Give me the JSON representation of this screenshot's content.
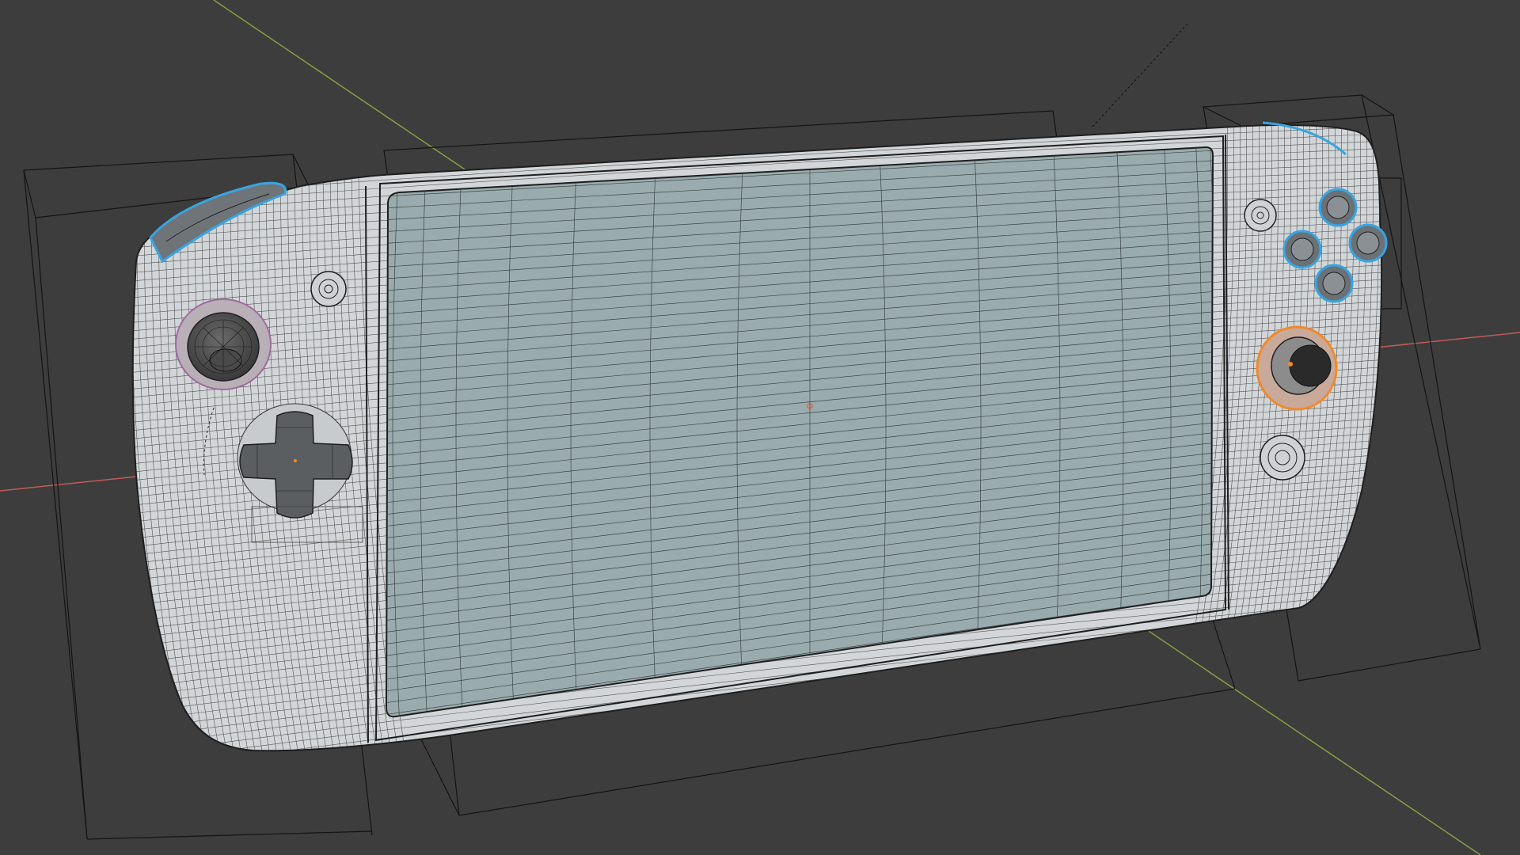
{
  "viewport": {
    "background": "#3d3d3d",
    "shading_mode": "wireframe-overlay-solid",
    "axis_colors": {
      "x": "#c25a5a",
      "y": "#84a040"
    },
    "selection_outline_color": "#38a4e0",
    "active_outline_color": "#f08a2c",
    "mesh_surface_color": "#d3d6d8",
    "screen_surface_color": "#9aabad",
    "wire_color": "#1e1e1e"
  },
  "scene": {
    "object_type": "handheld-game-console",
    "selected_parts": [
      "shoulder-button-left",
      "shoulder-button-right",
      "face-button-x",
      "face-button-y",
      "face-button-a",
      "face-button-b"
    ],
    "active_part": "analog-stick-right"
  }
}
